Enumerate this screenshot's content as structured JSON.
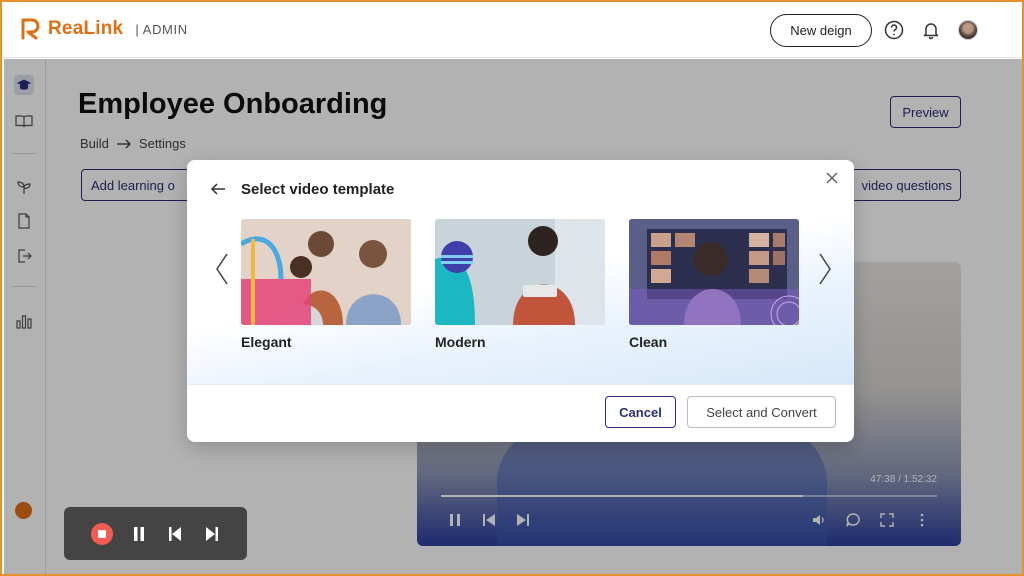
{
  "app": {
    "brand": "ReaLink",
    "section": "| ADMIN",
    "brand_color": "#e06e12"
  },
  "header": {
    "new_design_label": "New deign",
    "icons": [
      "help-icon",
      "bell-icon",
      "avatar"
    ]
  },
  "sidebar": {
    "icons": [
      "graduation-cap-icon",
      "book-icon",
      "sprout-icon",
      "file-icon",
      "exit-icon",
      "bar-chart-icon"
    ],
    "active": "graduation-cap-icon"
  },
  "page": {
    "title": "Employee Onboarding",
    "breadcrumb": [
      "Build",
      "Settings"
    ],
    "preview_label": "Preview",
    "add_learning_label": "Add learning o",
    "video_questions_label": "video questions",
    "accent": "#2b2d7a"
  },
  "video_player": {
    "time": "47:38 / 1:52:32",
    "progress": 0.73
  },
  "modal": {
    "title": "Select video template",
    "templates": [
      {
        "label": "Elegant"
      },
      {
        "label": "Modern"
      },
      {
        "label": "Clean"
      }
    ],
    "cancel_label": "Cancel",
    "convert_label": "Select and Convert"
  },
  "recorder": {
    "icons": [
      "stop-icon",
      "pause-icon",
      "skip-back-icon",
      "skip-forward-icon"
    ],
    "stop_color": "#f25c54"
  }
}
